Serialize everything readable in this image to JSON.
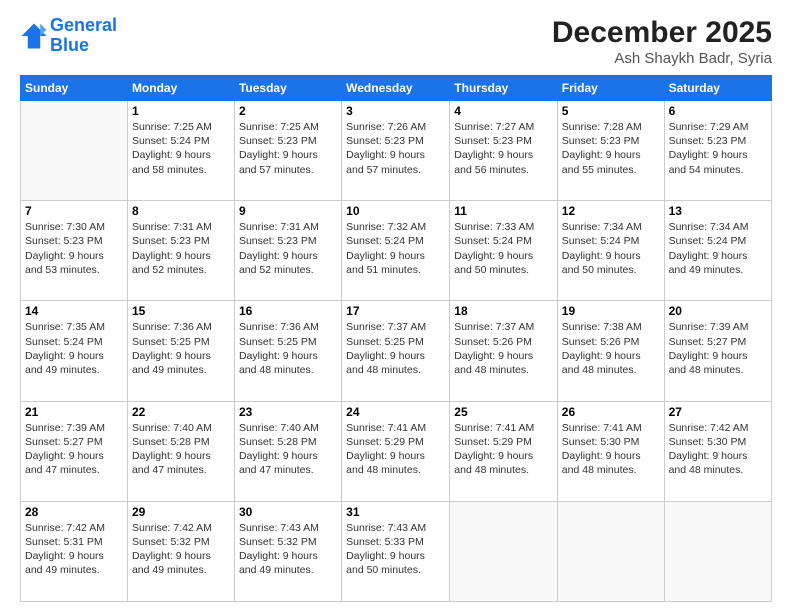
{
  "logo": {
    "line1": "General",
    "line2": "Blue"
  },
  "title": "December 2025",
  "subtitle": "Ash Shaykh Badr, Syria",
  "weekdays": [
    "Sunday",
    "Monday",
    "Tuesday",
    "Wednesday",
    "Thursday",
    "Friday",
    "Saturday"
  ],
  "weeks": [
    [
      {
        "day": "",
        "sunrise": "",
        "sunset": "",
        "daylight": ""
      },
      {
        "day": "1",
        "sunrise": "Sunrise: 7:25 AM",
        "sunset": "Sunset: 5:24 PM",
        "daylight": "Daylight: 9 hours and 58 minutes."
      },
      {
        "day": "2",
        "sunrise": "Sunrise: 7:25 AM",
        "sunset": "Sunset: 5:23 PM",
        "daylight": "Daylight: 9 hours and 57 minutes."
      },
      {
        "day": "3",
        "sunrise": "Sunrise: 7:26 AM",
        "sunset": "Sunset: 5:23 PM",
        "daylight": "Daylight: 9 hours and 57 minutes."
      },
      {
        "day": "4",
        "sunrise": "Sunrise: 7:27 AM",
        "sunset": "Sunset: 5:23 PM",
        "daylight": "Daylight: 9 hours and 56 minutes."
      },
      {
        "day": "5",
        "sunrise": "Sunrise: 7:28 AM",
        "sunset": "Sunset: 5:23 PM",
        "daylight": "Daylight: 9 hours and 55 minutes."
      },
      {
        "day": "6",
        "sunrise": "Sunrise: 7:29 AM",
        "sunset": "Sunset: 5:23 PM",
        "daylight": "Daylight: 9 hours and 54 minutes."
      }
    ],
    [
      {
        "day": "7",
        "sunrise": "Sunrise: 7:30 AM",
        "sunset": "Sunset: 5:23 PM",
        "daylight": "Daylight: 9 hours and 53 minutes."
      },
      {
        "day": "8",
        "sunrise": "Sunrise: 7:31 AM",
        "sunset": "Sunset: 5:23 PM",
        "daylight": "Daylight: 9 hours and 52 minutes."
      },
      {
        "day": "9",
        "sunrise": "Sunrise: 7:31 AM",
        "sunset": "Sunset: 5:23 PM",
        "daylight": "Daylight: 9 hours and 52 minutes."
      },
      {
        "day": "10",
        "sunrise": "Sunrise: 7:32 AM",
        "sunset": "Sunset: 5:24 PM",
        "daylight": "Daylight: 9 hours and 51 minutes."
      },
      {
        "day": "11",
        "sunrise": "Sunrise: 7:33 AM",
        "sunset": "Sunset: 5:24 PM",
        "daylight": "Daylight: 9 hours and 50 minutes."
      },
      {
        "day": "12",
        "sunrise": "Sunrise: 7:34 AM",
        "sunset": "Sunset: 5:24 PM",
        "daylight": "Daylight: 9 hours and 50 minutes."
      },
      {
        "day": "13",
        "sunrise": "Sunrise: 7:34 AM",
        "sunset": "Sunset: 5:24 PM",
        "daylight": "Daylight: 9 hours and 49 minutes."
      }
    ],
    [
      {
        "day": "14",
        "sunrise": "Sunrise: 7:35 AM",
        "sunset": "Sunset: 5:24 PM",
        "daylight": "Daylight: 9 hours and 49 minutes."
      },
      {
        "day": "15",
        "sunrise": "Sunrise: 7:36 AM",
        "sunset": "Sunset: 5:25 PM",
        "daylight": "Daylight: 9 hours and 49 minutes."
      },
      {
        "day": "16",
        "sunrise": "Sunrise: 7:36 AM",
        "sunset": "Sunset: 5:25 PM",
        "daylight": "Daylight: 9 hours and 48 minutes."
      },
      {
        "day": "17",
        "sunrise": "Sunrise: 7:37 AM",
        "sunset": "Sunset: 5:25 PM",
        "daylight": "Daylight: 9 hours and 48 minutes."
      },
      {
        "day": "18",
        "sunrise": "Sunrise: 7:37 AM",
        "sunset": "Sunset: 5:26 PM",
        "daylight": "Daylight: 9 hours and 48 minutes."
      },
      {
        "day": "19",
        "sunrise": "Sunrise: 7:38 AM",
        "sunset": "Sunset: 5:26 PM",
        "daylight": "Daylight: 9 hours and 48 minutes."
      },
      {
        "day": "20",
        "sunrise": "Sunrise: 7:39 AM",
        "sunset": "Sunset: 5:27 PM",
        "daylight": "Daylight: 9 hours and 48 minutes."
      }
    ],
    [
      {
        "day": "21",
        "sunrise": "Sunrise: 7:39 AM",
        "sunset": "Sunset: 5:27 PM",
        "daylight": "Daylight: 9 hours and 47 minutes."
      },
      {
        "day": "22",
        "sunrise": "Sunrise: 7:40 AM",
        "sunset": "Sunset: 5:28 PM",
        "daylight": "Daylight: 9 hours and 47 minutes."
      },
      {
        "day": "23",
        "sunrise": "Sunrise: 7:40 AM",
        "sunset": "Sunset: 5:28 PM",
        "daylight": "Daylight: 9 hours and 47 minutes."
      },
      {
        "day": "24",
        "sunrise": "Sunrise: 7:41 AM",
        "sunset": "Sunset: 5:29 PM",
        "daylight": "Daylight: 9 hours and 48 minutes."
      },
      {
        "day": "25",
        "sunrise": "Sunrise: 7:41 AM",
        "sunset": "Sunset: 5:29 PM",
        "daylight": "Daylight: 9 hours and 48 minutes."
      },
      {
        "day": "26",
        "sunrise": "Sunrise: 7:41 AM",
        "sunset": "Sunset: 5:30 PM",
        "daylight": "Daylight: 9 hours and 48 minutes."
      },
      {
        "day": "27",
        "sunrise": "Sunrise: 7:42 AM",
        "sunset": "Sunset: 5:30 PM",
        "daylight": "Daylight: 9 hours and 48 minutes."
      }
    ],
    [
      {
        "day": "28",
        "sunrise": "Sunrise: 7:42 AM",
        "sunset": "Sunset: 5:31 PM",
        "daylight": "Daylight: 9 hours and 49 minutes."
      },
      {
        "day": "29",
        "sunrise": "Sunrise: 7:42 AM",
        "sunset": "Sunset: 5:32 PM",
        "daylight": "Daylight: 9 hours and 49 minutes."
      },
      {
        "day": "30",
        "sunrise": "Sunrise: 7:43 AM",
        "sunset": "Sunset: 5:32 PM",
        "daylight": "Daylight: 9 hours and 49 minutes."
      },
      {
        "day": "31",
        "sunrise": "Sunrise: 7:43 AM",
        "sunset": "Sunset: 5:33 PM",
        "daylight": "Daylight: 9 hours and 50 minutes."
      },
      {
        "day": "",
        "sunrise": "",
        "sunset": "",
        "daylight": ""
      },
      {
        "day": "",
        "sunrise": "",
        "sunset": "",
        "daylight": ""
      },
      {
        "day": "",
        "sunrise": "",
        "sunset": "",
        "daylight": ""
      }
    ]
  ]
}
